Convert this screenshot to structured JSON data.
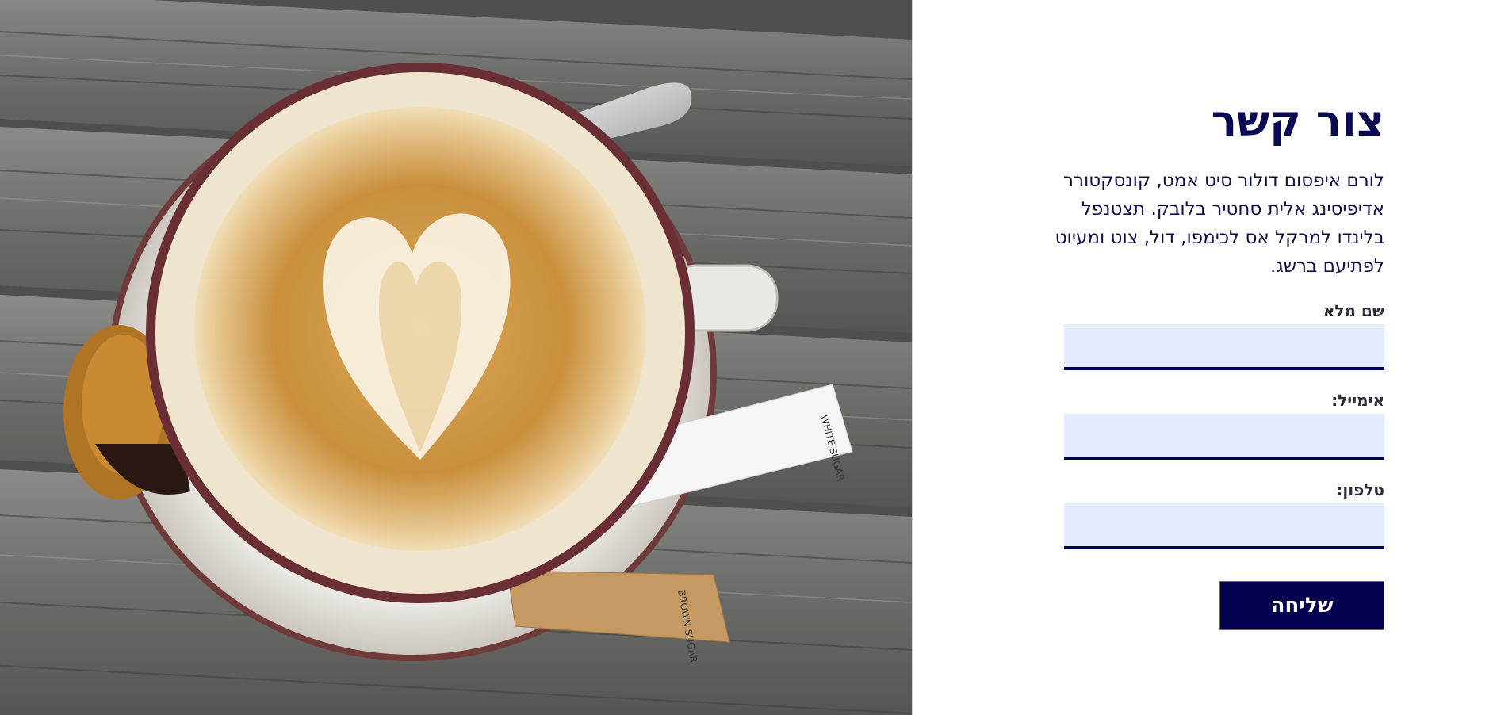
{
  "photo": {
    "subject": "latte-art-coffee-cup",
    "sugar_stick_text_1": "WHITE SUGAR",
    "sugar_stick_text_2": "BROWN SUGAR"
  },
  "contact": {
    "title": "צור קשר",
    "description": "לורם איפסום דולור סיט אמט, קונסקטורר אדיפיסינג אלית סחטיר בלובק. תצטנפל בלינדו למרקל אס לכימפו, דול, צוט ומעיוט לפתיעם ברשג.",
    "fields": [
      {
        "label": "שם מלא",
        "value": ""
      },
      {
        "label": "אימייל:",
        "value": ""
      },
      {
        "label": "טלפון:",
        "value": ""
      }
    ],
    "submit_label": "שליחה"
  },
  "colors": {
    "accent": "#03004e",
    "input_background": "#e4ecff",
    "title": "#0a0a52"
  }
}
